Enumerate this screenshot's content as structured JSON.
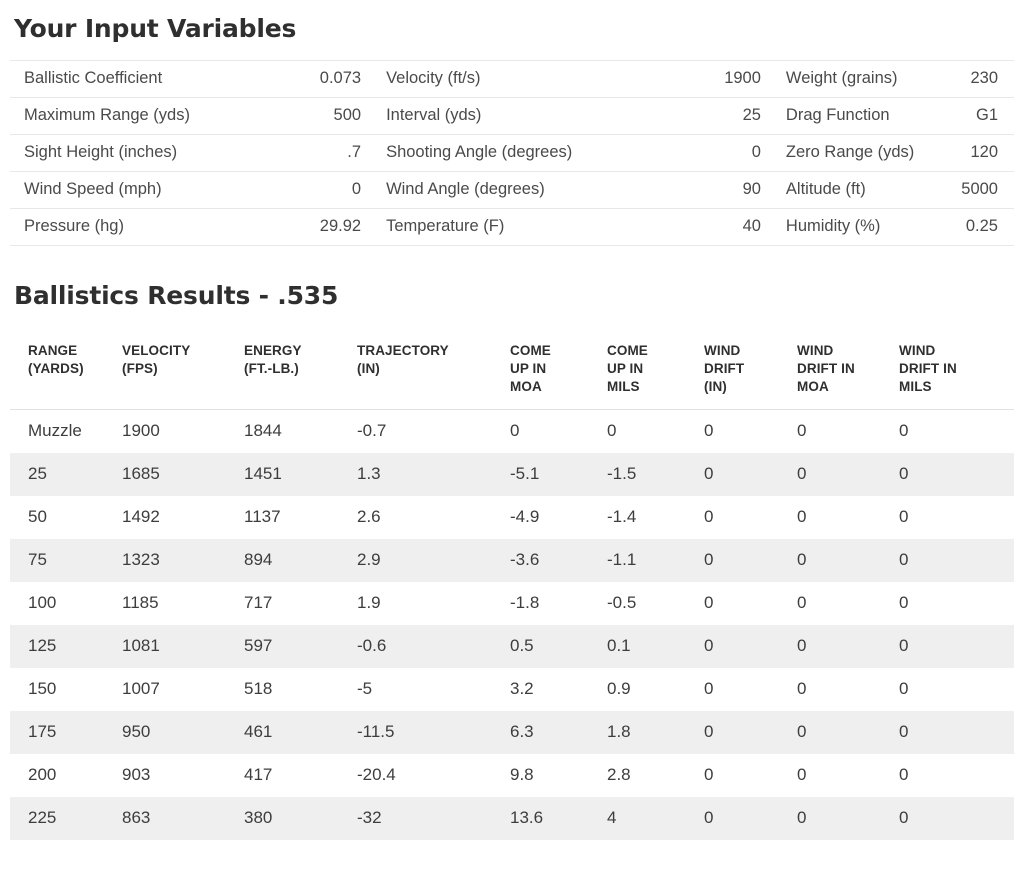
{
  "input_section": {
    "heading": "Your Input Variables",
    "rows": [
      [
        {
          "label": "Ballistic Coefficient",
          "value": "0.073"
        },
        {
          "label": "Velocity (ft/s)",
          "value": "1900"
        },
        {
          "label": "Weight (grains)",
          "value": "230"
        }
      ],
      [
        {
          "label": "Maximum Range (yds)",
          "value": "500"
        },
        {
          "label": "Interval (yds)",
          "value": "25"
        },
        {
          "label": "Drag Function",
          "value": "G1"
        }
      ],
      [
        {
          "label": "Sight Height (inches)",
          "value": ".7"
        },
        {
          "label": "Shooting Angle (degrees)",
          "value": "0"
        },
        {
          "label": "Zero Range (yds)",
          "value": "120"
        }
      ],
      [
        {
          "label": "Wind Speed (mph)",
          "value": "0"
        },
        {
          "label": "Wind Angle (degrees)",
          "value": "90"
        },
        {
          "label": "Altitude (ft)",
          "value": "5000"
        }
      ],
      [
        {
          "label": "Pressure (hg)",
          "value": "29.92"
        },
        {
          "label": "Temperature (F)",
          "value": "40"
        },
        {
          "label": "Humidity (%)",
          "value": "0.25"
        }
      ]
    ]
  },
  "results_section": {
    "heading": "Ballistics Results - .535",
    "columns": [
      {
        "line1": "RANGE",
        "line2": "(YARDS)",
        "line3": ""
      },
      {
        "line1": "VELOCITY",
        "line2": "(FPS)",
        "line3": ""
      },
      {
        "line1": "ENERGY",
        "line2": "(FT.-LB.)",
        "line3": ""
      },
      {
        "line1": "TRAJECTORY",
        "line2": "(IN)",
        "line3": ""
      },
      {
        "line1": "COME",
        "line2": "UP IN",
        "line3": "MOA"
      },
      {
        "line1": "COME",
        "line2": "UP IN",
        "line3": "MILS"
      },
      {
        "line1": "WIND",
        "line2": "DRIFT",
        "line3": "(IN)"
      },
      {
        "line1": "WIND",
        "line2": "DRIFT IN",
        "line3": "MOA"
      },
      {
        "line1": "WIND",
        "line2": "DRIFT IN",
        "line3": "MILS"
      }
    ],
    "rows": [
      [
        "Muzzle",
        "1900",
        "1844",
        "-0.7",
        "0",
        "0",
        "0",
        "0",
        "0"
      ],
      [
        "25",
        "1685",
        "1451",
        "1.3",
        "-5.1",
        "-1.5",
        "0",
        "0",
        "0"
      ],
      [
        "50",
        "1492",
        "1137",
        "2.6",
        "-4.9",
        "-1.4",
        "0",
        "0",
        "0"
      ],
      [
        "75",
        "1323",
        "894",
        "2.9",
        "-3.6",
        "-1.1",
        "0",
        "0",
        "0"
      ],
      [
        "100",
        "1185",
        "717",
        "1.9",
        "-1.8",
        "-0.5",
        "0",
        "0",
        "0"
      ],
      [
        "125",
        "1081",
        "597",
        "-0.6",
        "0.5",
        "0.1",
        "0",
        "0",
        "0"
      ],
      [
        "150",
        "1007",
        "518",
        "-5",
        "3.2",
        "0.9",
        "0",
        "0",
        "0"
      ],
      [
        "175",
        "950",
        "461",
        "-11.5",
        "6.3",
        "1.8",
        "0",
        "0",
        "0"
      ],
      [
        "200",
        "903",
        "417",
        "-20.4",
        "9.8",
        "2.8",
        "0",
        "0",
        "0"
      ],
      [
        "225",
        "863",
        "380",
        "-32",
        "13.6",
        "4",
        "0",
        "0",
        "0"
      ]
    ]
  },
  "chart_data": {
    "type": "table",
    "title": "Ballistics Results - .535",
    "columns": [
      "RANGE (YARDS)",
      "VELOCITY (FPS)",
      "ENERGY (FT.-LB.)",
      "TRAJECTORY (IN)",
      "COME UP IN MOA",
      "COME UP IN MILS",
      "WIND DRIFT (IN)",
      "WIND DRIFT IN MOA",
      "WIND DRIFT IN MILS"
    ],
    "rows": [
      [
        "Muzzle",
        1900,
        1844,
        -0.7,
        0,
        0,
        0,
        0,
        0
      ],
      [
        "25",
        1685,
        1451,
        1.3,
        -5.1,
        -1.5,
        0,
        0,
        0
      ],
      [
        "50",
        1492,
        1137,
        2.6,
        -4.9,
        -1.4,
        0,
        0,
        0
      ],
      [
        "75",
        1323,
        894,
        2.9,
        -3.6,
        -1.1,
        0,
        0,
        0
      ],
      [
        "100",
        1185,
        717,
        1.9,
        -1.8,
        -0.5,
        0,
        0,
        0
      ],
      [
        "125",
        1081,
        597,
        -0.6,
        0.5,
        0.1,
        0,
        0,
        0
      ],
      [
        "150",
        1007,
        518,
        -5,
        3.2,
        0.9,
        0,
        0,
        0
      ],
      [
        "175",
        950,
        461,
        -11.5,
        6.3,
        1.8,
        0,
        0,
        0
      ],
      [
        "200",
        903,
        417,
        -20.4,
        9.8,
        2.8,
        0,
        0,
        0
      ],
      [
        "225",
        863,
        380,
        -32,
        13.6,
        4,
        0,
        0,
        0
      ]
    ]
  }
}
